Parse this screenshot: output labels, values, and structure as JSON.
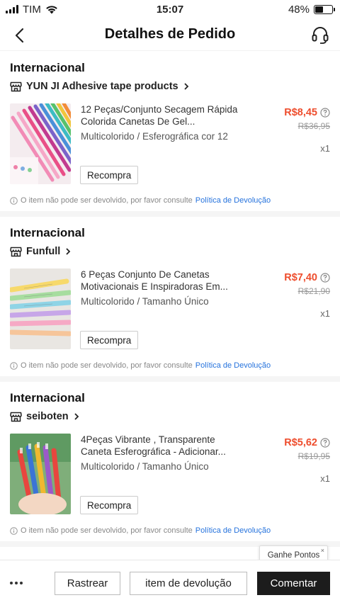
{
  "status_bar": {
    "carrier": "TIM",
    "time": "15:07",
    "battery": "48%",
    "battery_level": 0.48
  },
  "header": {
    "title": "Detalhes de Pedido"
  },
  "orders": [
    {
      "region": "Internacional",
      "shop": "YUN JI Adhesive tape products",
      "title": "12 Peças/Conjunto Secagem Rápida Colorida Canetas De Gel...",
      "variant": "Multicolorido / Esferográfica cor 12",
      "price": "R$8,45",
      "old_price": "R$36,95",
      "qty": "x1",
      "rebuy": "Recompra"
    },
    {
      "region": "Internacional",
      "shop": "Funfull",
      "title": "6 Peças Conjunto De Canetas Motivacionais E Inspiradoras Em...",
      "variant": "Multicolorido / Tamanho Único",
      "price": "R$7,40",
      "old_price": "R$21,90",
      "qty": "x1",
      "rebuy": "Recompra"
    },
    {
      "region": "Internacional",
      "shop": "seiboten",
      "title": "4Peças Vibrante , Transparente Caneta Esferográfica - Adicionar...",
      "variant": "Multicolorido / Tamanho Único",
      "price": "R$5,62",
      "old_price": "R$19,95",
      "qty": "x1",
      "rebuy": "Recompra"
    }
  ],
  "return_note": {
    "text": "O item não pode ser devolvido, por favor consulte",
    "link": "Política de Devolução"
  },
  "bottom_bar": {
    "track": "Rastrear",
    "return_item": "item de devolução",
    "comment": "Comentar"
  },
  "tooltip": {
    "text": "Ganhe Pontos",
    "close": "×"
  },
  "colors": {
    "accent": "#ee4d2d",
    "link": "#2673dd"
  }
}
